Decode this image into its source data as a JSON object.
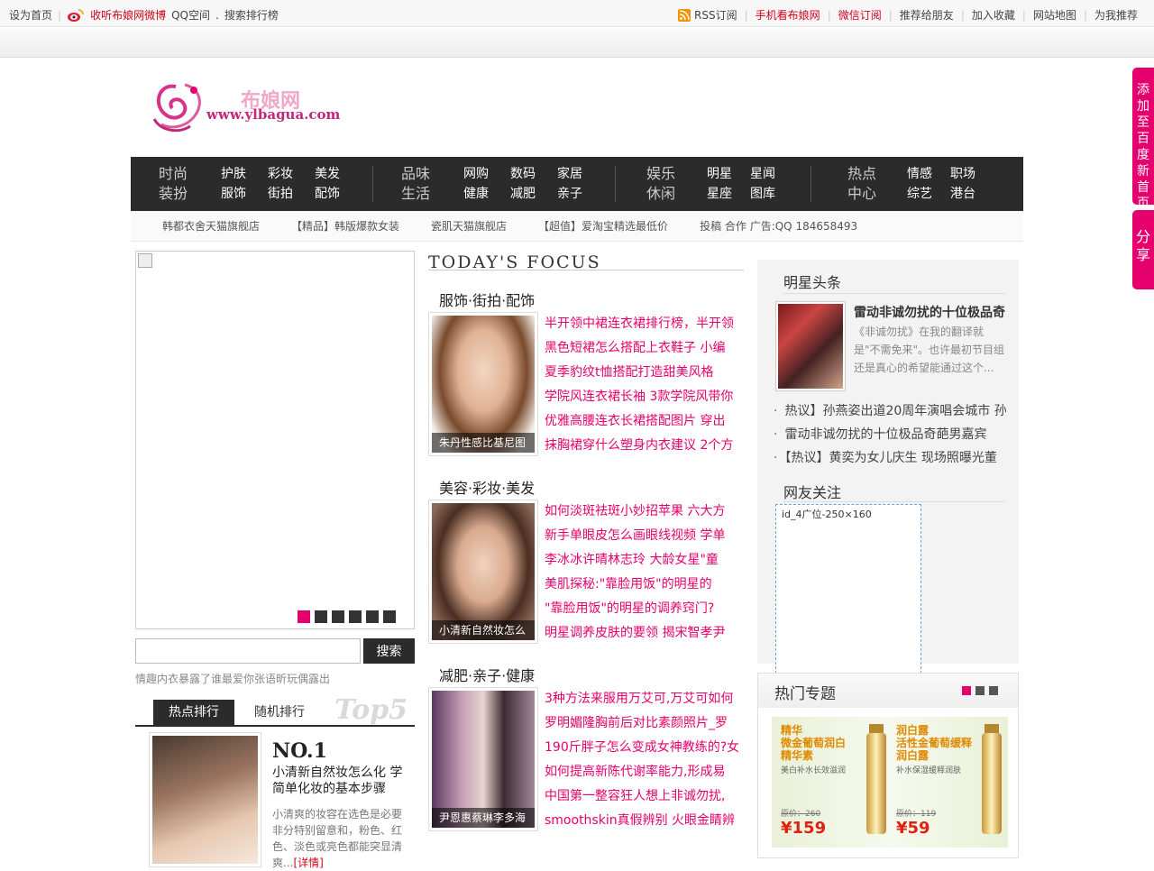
{
  "topbar": {
    "set_home": "设为首页",
    "weibo": "收听布娘网微博",
    "qq": "QQ空间",
    "dot": ".",
    "search_rank": "搜索排行榜",
    "rss": "RSS订阅",
    "mobile": "手机看布娘网",
    "wechat": "微信订阅",
    "recommend": "推荐给朋友",
    "favorite": "加入收藏",
    "sitemap": "网站地图",
    "suggest": "为我推荐"
  },
  "logo": {
    "cn": "布娘网",
    "url": "www.ylbagua.com"
  },
  "nav": [
    {
      "category": "时尚装扮",
      "cat1": "时尚",
      "cat2": "装扮",
      "links": [
        "护肤",
        "彩妆",
        "美发",
        "服饰",
        "街拍",
        "配饰"
      ]
    },
    {
      "category": "品味生活",
      "cat1": "品味",
      "cat2": "生活",
      "links": [
        "网购",
        "数码",
        "家居",
        "健康",
        "减肥",
        "亲子"
      ]
    },
    {
      "category": "娱乐休闲",
      "cat1": "娱乐",
      "cat2": "休闲",
      "links": [
        "明星",
        "星闻",
        "星座",
        "图库"
      ]
    },
    {
      "category": "热点中心",
      "cat1": "热点",
      "cat2": "中心",
      "links": [
        "情感",
        "职场",
        "综艺",
        "港台"
      ]
    }
  ],
  "adlinks": [
    "韩都衣舍天猫旗舰店",
    "【精品】韩版爆款女装",
    "瓷肌天猫旗舰店",
    "【超值】爱淘宝精选最低价",
    "投稿 合作 广告:QQ 184658493"
  ],
  "search": {
    "button": "搜索",
    "hot_text": "情趣内衣暴露了谁最爱你张语昕玩偶露出"
  },
  "rank": {
    "tab_hot": "热点排行",
    "tab_random": "随机排行",
    "badge": "Top5",
    "no": "NO.1",
    "title": "小清新自然妆怎么化 学简单化妆的基本步骤",
    "desc": "小清爽的妆容在选色是必要非分特别留意和，粉色、红色、淡色或亮色都能突显清爽...",
    "more": "[详情]"
  },
  "focus": {
    "heading": "TODAY'S FOCUS"
  },
  "sections": [
    {
      "title": "服饰·街拍·配饰",
      "caption": "朱丹性感比基尼图",
      "items": [
        "半开领中裙连衣裙排行榜，半开领",
        "黑色短裙怎么搭配上衣鞋子 小编",
        "夏季豹纹t恤搭配打造甜美风格",
        "学院风连衣裙长袖 3款学院风带你",
        "优雅高腰连衣长裙搭配图片 穿出",
        "抹胸裙穿什么塑身内衣建议 2个方"
      ]
    },
    {
      "title": "美容·彩妆·美发",
      "caption": "小清新自然妆怎么",
      "items": [
        "如何淡斑祛斑小妙招苹果 六大方",
        "新手单眼皮怎么画眼线视频 学单",
        "李冰冰许晴林志玲 大龄女星\"童",
        "美肌探秘:\"靠脸用饭\"的明星的",
        "\"靠脸用饭\"的明星的调养窍门?",
        "明星调养皮肤的要领 揭宋智孝尹"
      ]
    },
    {
      "title": "减肥·亲子·健康",
      "caption": "尹恩惠蔡琳李多海",
      "items": [
        "3种方法来服用万艾可,万艾可如何",
        "罗明媚隆胸前后对比素颜照片_罗",
        "190斤胖子怎么变成女神教练的?女",
        "如何提高新陈代谢率能力,形成易",
        "中国第一整容狂人想上非诚勿扰,",
        "smoothskin真假辨别 火眼金睛辨"
      ]
    }
  ],
  "stars": {
    "heading": "明星头条",
    "title": "雷动非诚勿扰的十位极品奇",
    "desc": "《非诚勿扰》在我的翻译就是\"不需免来\"。也许最初节目组还是真心的希望能通过这个...",
    "list": [
      "热议】孙燕姿出道20周年演唱会城市 孙",
      "雷动非诚勿扰的十位极品奇葩男嘉宾",
      "【热议】黄奕为女儿庆生 现场照曝光董"
    ]
  },
  "follow": {
    "heading": "网友关注",
    "ad": "id_4广位-250×160"
  },
  "hot_topic": {
    "heading": "热门专题",
    "products": [
      {
        "line1": "精华",
        "line2": "微金葡萄润白",
        "line3": "精华素",
        "sub": "美白补水长效滋润",
        "old": "原价：260",
        "price": "¥159"
      },
      {
        "line1": "润白露",
        "line2": "活性金葡萄缓释",
        "line3": "润白露",
        "sub": "补水保湿缓释润肤",
        "old": "原价：119",
        "price": "¥59"
      }
    ]
  },
  "side": {
    "add_home": "添加至百度新首页",
    "share": "分享"
  },
  "colors": {
    "accent": "#e5006e",
    "nav_bg": "#2b2b2b",
    "red_link": "#d0021b"
  }
}
